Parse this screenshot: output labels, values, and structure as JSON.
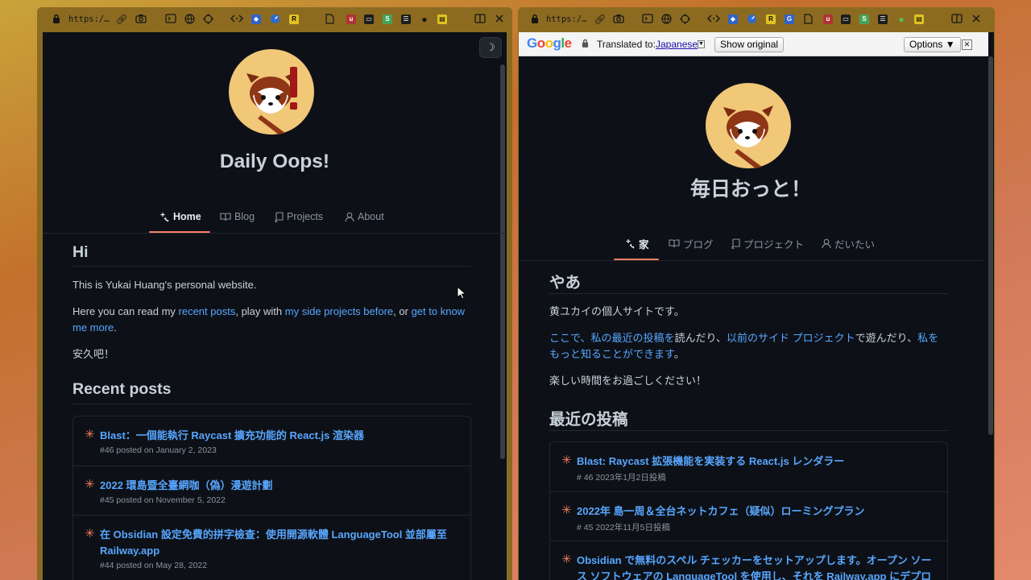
{
  "left": {
    "url": "https:/…",
    "site_title": "Daily Oops!",
    "theme_toggle_glyph": "☽",
    "nav": [
      {
        "label": "Home",
        "icon": "sparkle-icon",
        "active": true
      },
      {
        "label": "Blog",
        "icon": "book-icon",
        "active": false
      },
      {
        "label": "Projects",
        "icon": "repo-icon",
        "active": false
      },
      {
        "label": "About",
        "icon": "person-icon",
        "active": false
      }
    ],
    "intro": {
      "heading": "Hi",
      "p1": "This is Yukai Huang's personal website.",
      "p2_a": "Here you can read my ",
      "p2_link1": "recent posts",
      "p2_b": ", play with ",
      "p2_link2": "my side projects before",
      "p2_c": ", or ",
      "p2_link3": "get to know me more",
      "p2_d": ".",
      "p3": "安久吧！"
    },
    "recent_heading": "Recent posts",
    "posts": [
      {
        "title": "Blast：一個能執行 Raycast 擴充功能的 React.js 渲染器",
        "meta": "#46 posted on January 2, 2023"
      },
      {
        "title": "2022 環島暨全臺網咖（偽）漫遊計劃",
        "meta": "#45 posted on November 5, 2022"
      },
      {
        "title": "在 Obsidian 設定免費的拼字檢查：使用開源軟體 LanguageTool 並部屬至 Railway.app",
        "meta": "#44 posted on May 28, 2022"
      }
    ]
  },
  "right": {
    "url": "https:/…",
    "translate_bar": {
      "logo": "Google",
      "label": "Translated to:",
      "language": "Japanese",
      "show_original": "Show original",
      "options": "Options ▼",
      "close": "✕"
    },
    "site_title": "毎日おっと！",
    "nav": [
      {
        "label": "家",
        "icon": "sparkle-icon",
        "active": true
      },
      {
        "label": "ブログ",
        "icon": "book-icon",
        "active": false
      },
      {
        "label": "プロジェクト",
        "icon": "repo-icon",
        "active": false
      },
      {
        "label": "だいたい",
        "icon": "person-icon",
        "active": false
      }
    ],
    "intro": {
      "heading": "やあ",
      "p1": "黄ユカイの個人サイトです。",
      "p2_link1": "ここで、私の最近の投稿を",
      "p2_a": "読んだり、",
      "p2_link2": "以前のサイド プロジェクト",
      "p2_b": "で遊んだり、",
      "p2_link3": "私をもっと知ることができます",
      "p2_c": "。",
      "p3": "楽しい時間をお過ごしください！"
    },
    "recent_heading": "最近の投稿",
    "posts": [
      {
        "title": "Blast: Raycast 拡張機能を実装する React.js レンダラー",
        "meta": "# 46 2023年1月2日投稿"
      },
      {
        "title": "2022年 島一周＆全台ネットカフェ（疑似）ローミングプラン",
        "meta": "# 45 2022年11月5日投稿"
      },
      {
        "title": "Obsidian で無料のスペル チェッカーをセットアップします。オープン ソース ソフトウェアの LanguageTool を使用し、それを Railway.app にデプロイします",
        "meta": ""
      }
    ]
  },
  "colors": {
    "link": "#58a6ff",
    "accent": "#f78166",
    "bg": "#0d1117"
  }
}
